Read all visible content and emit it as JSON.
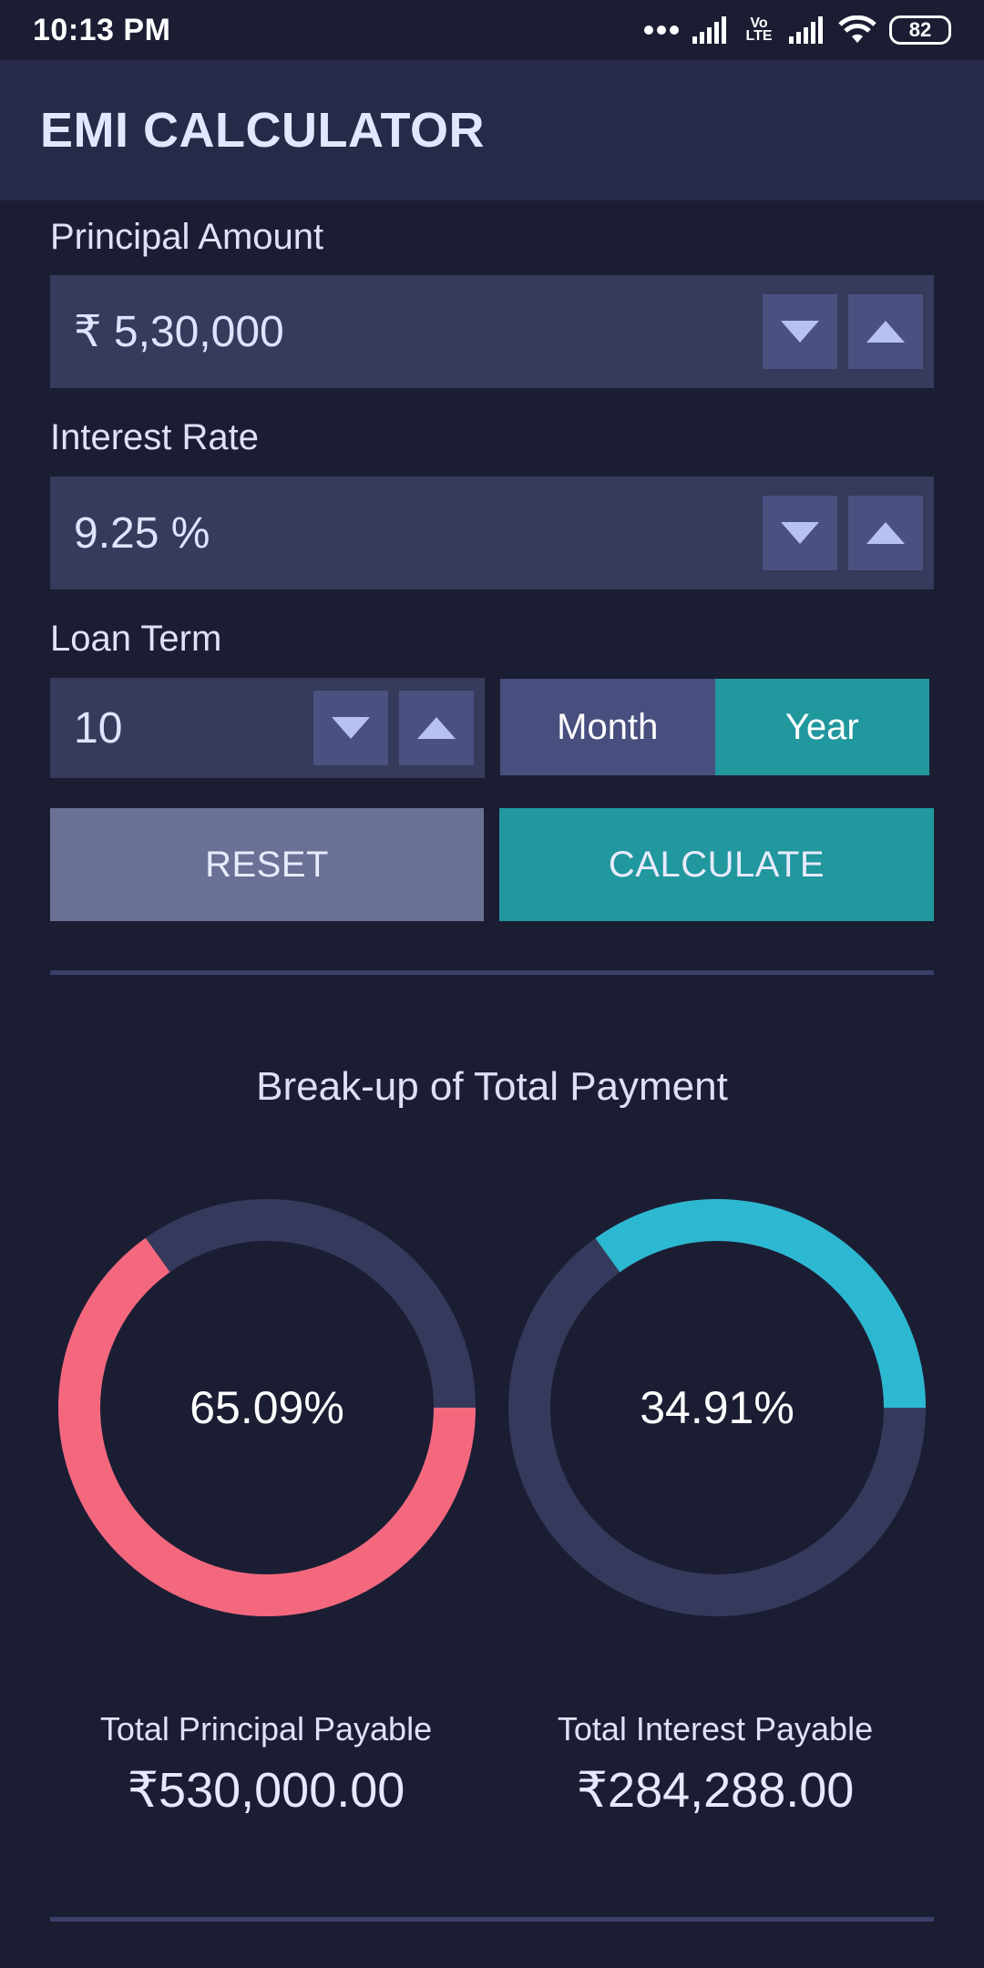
{
  "status_bar": {
    "time": "10:13 PM",
    "battery": "82",
    "volte_label": "Vo LTE"
  },
  "app_bar": {
    "title": "EMI CALCULATOR"
  },
  "principal": {
    "label": "Principal Amount",
    "value": "₹ 5,30,000"
  },
  "interest": {
    "label": "Interest Rate",
    "value": "9.25 %"
  },
  "loan_term": {
    "label": "Loan Term",
    "value": "10",
    "unit_options": [
      "Month",
      "Year"
    ],
    "selected_unit": "Year"
  },
  "buttons": {
    "reset": "RESET",
    "calculate": "CALCULATE"
  },
  "breakup": {
    "title": "Break-up of Total Payment",
    "principal_percent_text": "65.09%",
    "principal_fraction": 0.6509,
    "interest_percent_text": "34.91%",
    "interest_fraction": 0.3491,
    "principal_label": "Total Principal Payable",
    "principal_value": "₹530,000.00",
    "interest_label": "Total Interest Payable",
    "interest_value": "₹284,288.00"
  },
  "colors": {
    "background": "#1b1d33",
    "app_bar": "#262a48",
    "accent_teal": "#21979e",
    "principal_arc": "#f4687e",
    "interest_arc": "#2db8d1",
    "ring_track": "#353a5c"
  },
  "icons": [
    "signal-dots-icon",
    "signal-bars-icon",
    "volte-icon",
    "wifi-icon",
    "battery-icon",
    "chevron-down-icon",
    "chevron-up-icon"
  ]
}
